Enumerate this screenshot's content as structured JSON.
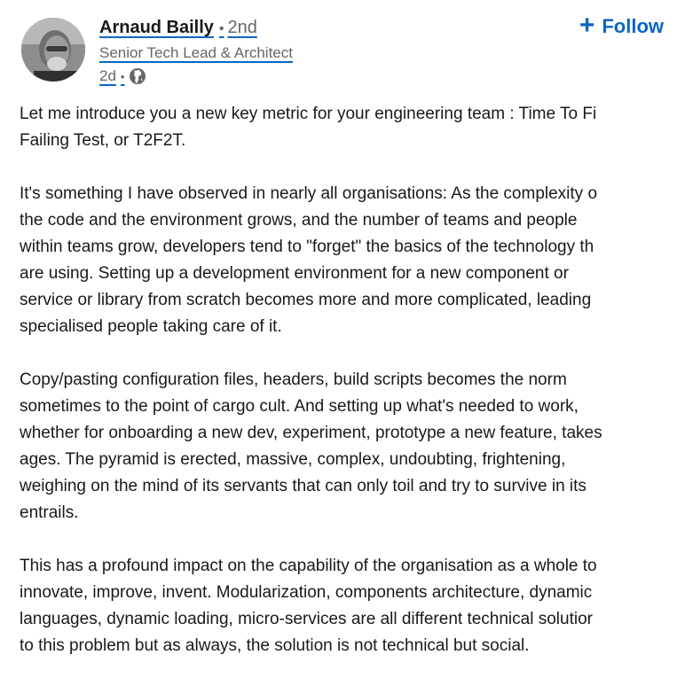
{
  "author": {
    "name": "Arnaud Bailly",
    "degree": "2nd",
    "degree_separator": "•",
    "headline": "Senior Tech Lead & Architect",
    "posted_time": "2d",
    "meta_separator": "•",
    "visibility_icon": "globe-icon",
    "avatar_icon": "profile-photo"
  },
  "actions": {
    "follow_icon": "plus-icon",
    "follow_label": "Follow"
  },
  "colors": {
    "accent": "#0a66c2",
    "text": "#191919",
    "muted": "#666666"
  },
  "post": {
    "paragraphs": [
      {
        "lines": [
          "Let me introduce you a new key metric for your engineering team : Time To Fi",
          "Failing Test, or T2F2T."
        ]
      },
      {
        "lines": [
          "It's something I have observed in nearly all organisations: As the complexity o",
          "the code and the environment grows, and the number of teams and people",
          "within teams grow, developers tend to \"forget\" the basics of the technology th",
          "are using. Setting up a development environment for a new component or",
          "service or library from scratch becomes more and more complicated, leading",
          "specialised people taking care of it."
        ]
      },
      {
        "lines": [
          "Copy/pasting configuration files, headers, build scripts becomes the norm",
          "sometimes to the point of cargo cult. And setting up what's needed to work,",
          "whether for onboarding a new dev, experiment, prototype a new feature, takes",
          "ages. The pyramid is erected, massive, complex, undoubting, frightening,",
          "weighing on the mind of its servants that can only toil and try to survive in its",
          "entrails."
        ]
      },
      {
        "lines": [
          "This has a profound impact on the capability of the organisation as a whole to",
          "innovate, improve, invent. Modularization, components architecture, dynamic",
          "languages, dynamic loading, micro-services are all different technical solutior",
          "to this problem but as always, the solution is not technical but social."
        ]
      }
    ]
  }
}
